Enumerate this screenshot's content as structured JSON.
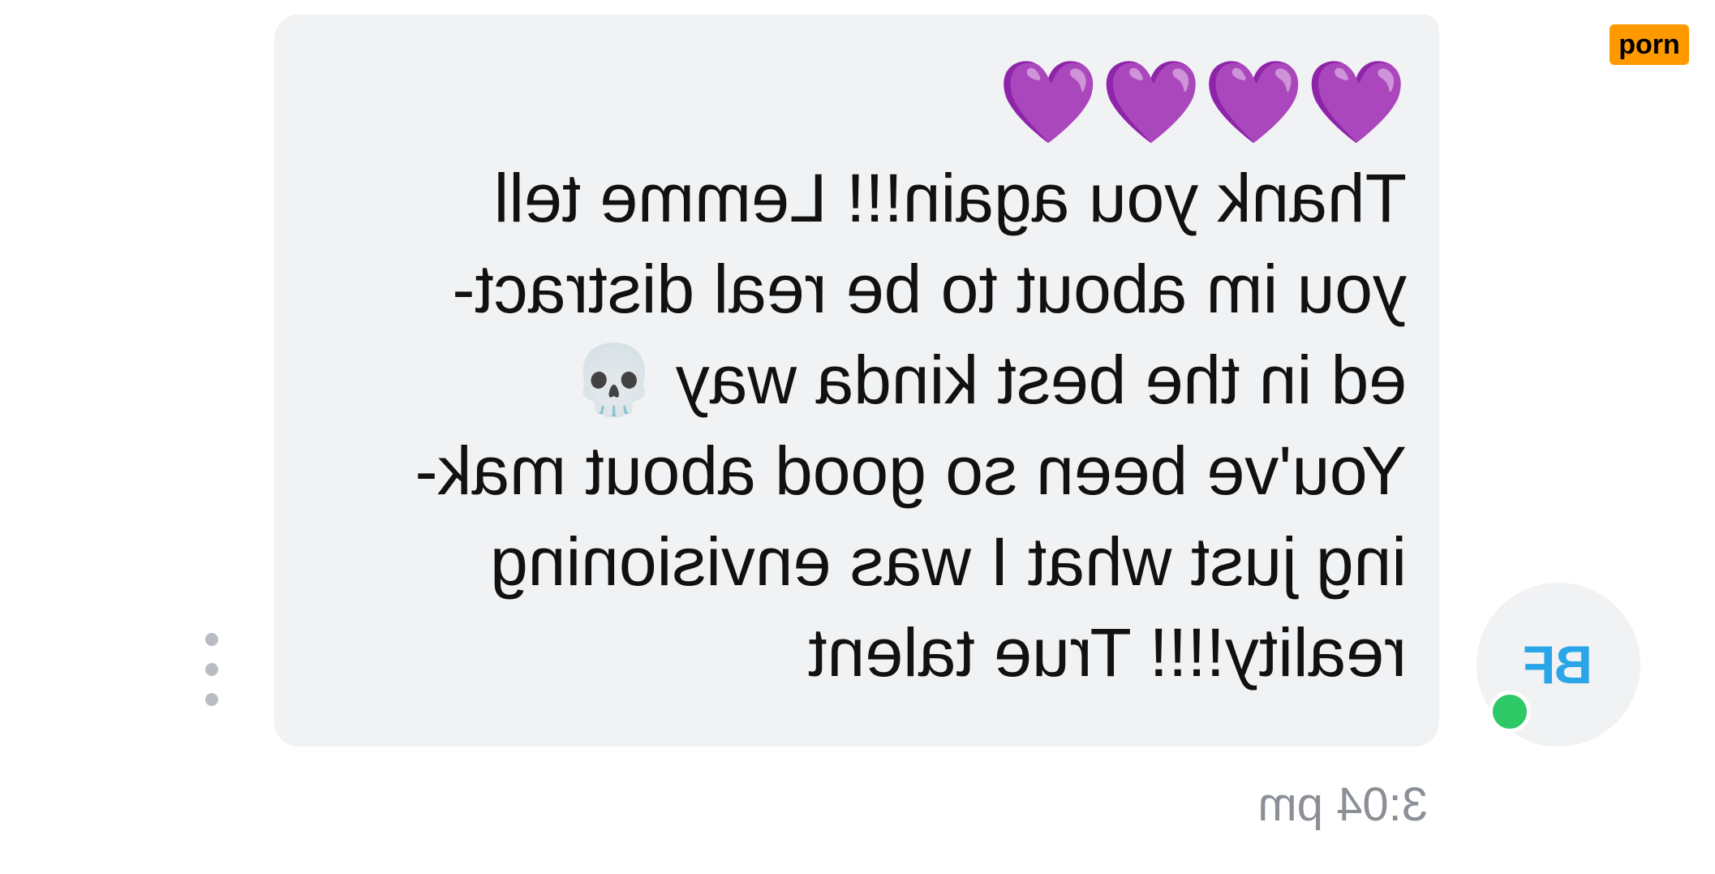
{
  "message": {
    "emoji_header": "💜💜💜💜",
    "lines": [
      "Thank you again!!! Lemme tell",
      "you im about to be real distract-",
      "ed in the best kinda way",
      "You've been so good about mak-",
      "ing just what I was envisioning",
      "reality!!!! True talent"
    ],
    "inline_emoji": "💀",
    "timestamp": "3:04 pm"
  },
  "sender": {
    "initials": "BF",
    "online": true
  },
  "watermark_badge": "porn",
  "icons": {
    "more_menu": "more-vertical-icon",
    "presence": "online-status-dot"
  },
  "colors": {
    "bubble_bg": "#f1f2f4",
    "text": "#111111",
    "initials": "#2aa6e8",
    "online": "#2ec866",
    "timestamp": "#8b8f96",
    "badge_bg": "#ff9900"
  }
}
